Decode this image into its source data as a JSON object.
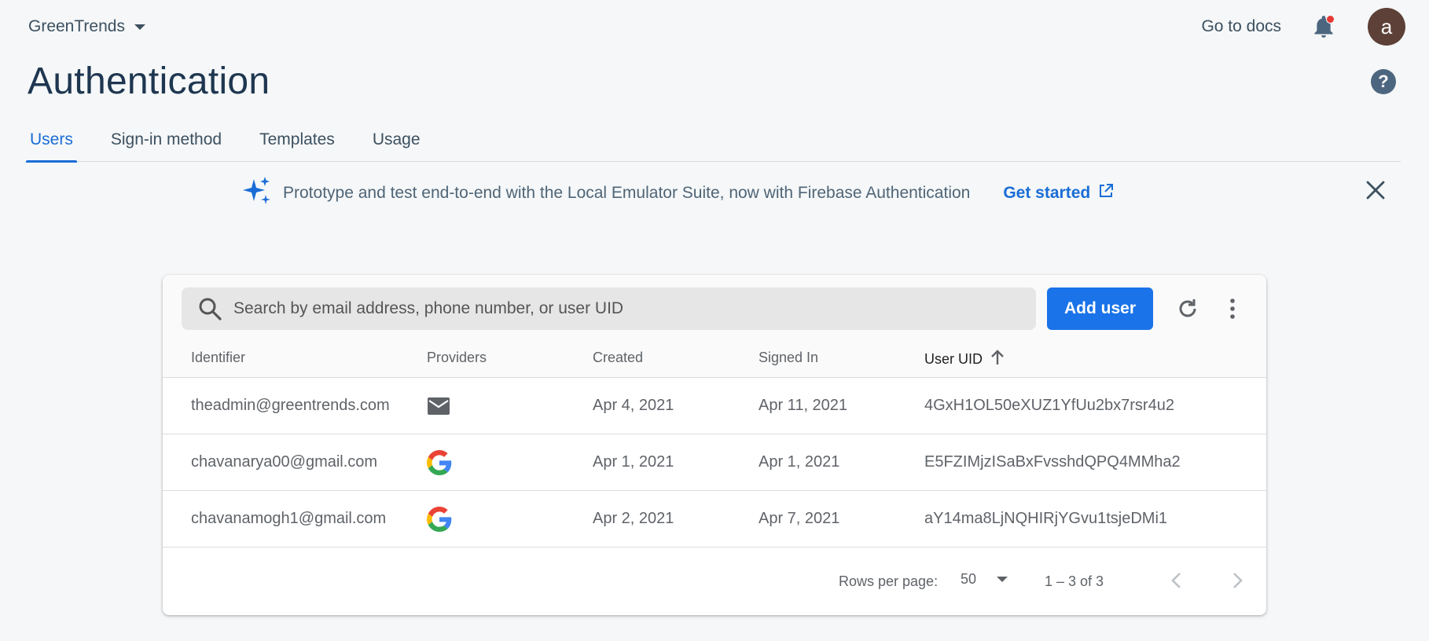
{
  "header": {
    "project_name": "GreenTrends",
    "docs_link": "Go to docs",
    "avatar_letter": "a",
    "accent": "#1a73e8"
  },
  "page": {
    "title": "Authentication",
    "tabs": [
      {
        "label": "Users",
        "active": true
      },
      {
        "label": "Sign-in method",
        "active": false
      },
      {
        "label": "Templates",
        "active": false
      },
      {
        "label": "Usage",
        "active": false
      }
    ]
  },
  "banner": {
    "text": "Prototype and test end-to-end with the Local Emulator Suite, now with Firebase Authentication",
    "link": "Get started"
  },
  "toolbar": {
    "search_placeholder": "Search by email address, phone number, or user UID",
    "add_user_label": "Add user"
  },
  "table": {
    "columns": [
      "Identifier",
      "Providers",
      "Created",
      "Signed In",
      "User UID"
    ],
    "sorted_column": "User UID",
    "rows": [
      {
        "identifier": "theadmin@greentrends.com",
        "provider": "email-icon",
        "created": "Apr 4, 2021",
        "signed_in": "Apr 11, 2021",
        "uid": "4GxH1OL50eXUZ1YfUu2bx7rsr4u2"
      },
      {
        "identifier": "chavanarya00@gmail.com",
        "provider": "google-icon",
        "created": "Apr 1, 2021",
        "signed_in": "Apr 1, 2021",
        "uid": "E5FZIMjzISaBxFvsshdQPQ4MMha2"
      },
      {
        "identifier": "chavanamogh1@gmail.com",
        "provider": "google-icon",
        "created": "Apr 2, 2021",
        "signed_in": "Apr 7, 2021",
        "uid": "aY14ma8LjNQHIRjYGvu1tsjeDMi1"
      }
    ]
  },
  "pagination": {
    "rows_per_page_label": "Rows per page:",
    "rows_per_page_value": "50",
    "range_text": "1 – 3 of 3"
  }
}
